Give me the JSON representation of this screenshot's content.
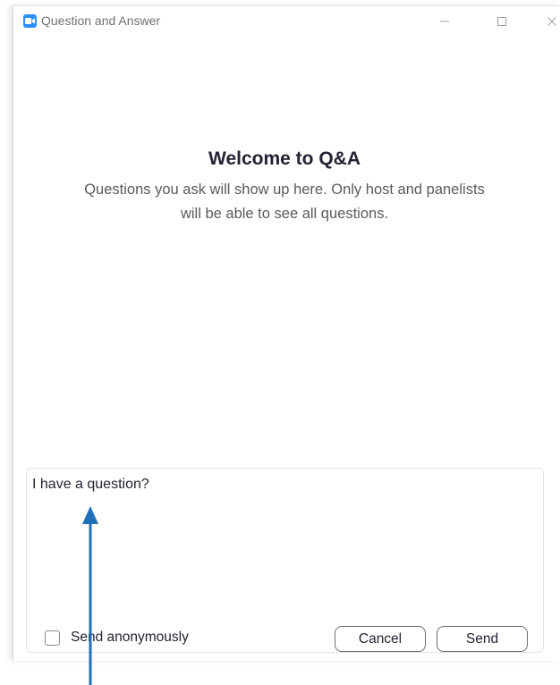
{
  "window": {
    "title": "Question and Answer",
    "app_icon": "zoom-video-camera-icon",
    "controls": [
      "minimize-icon",
      "maximize-icon",
      "close-icon"
    ]
  },
  "welcome": {
    "title": "Welcome to Q&A",
    "description": "Questions you ask will show up here. Only host and panelists will be able to see all questions."
  },
  "composer": {
    "question_value": "I have a question?",
    "send_anonymously_label": "Send anonymously",
    "send_anonymously_checked": false,
    "cancel_label": "Cancel",
    "send_label": "Send"
  },
  "annotation": {
    "arrow_color": "#1f6fb8"
  },
  "colors": {
    "brand": "#2d8cff",
    "text": "#232333"
  }
}
